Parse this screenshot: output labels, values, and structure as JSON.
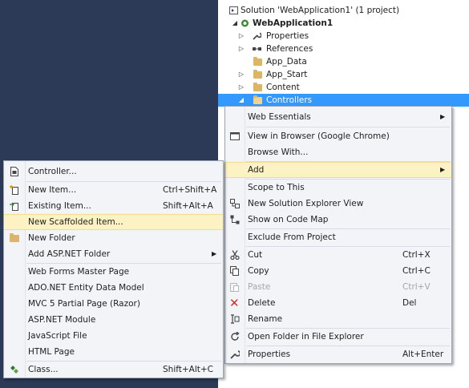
{
  "solution_explorer": {
    "solution_label": "Solution 'WebApplication1' (1 project)",
    "project_label": "WebApplication1",
    "nodes": [
      {
        "label": "Properties"
      },
      {
        "label": "References"
      },
      {
        "label": "App_Data"
      },
      {
        "label": "App_Start"
      },
      {
        "label": "Content"
      },
      {
        "label": "Controllers"
      }
    ]
  },
  "context_menu": {
    "web_essentials": "Web Essentials",
    "view_in_browser": "View in Browser (Google Chrome)",
    "browse_with": "Browse With...",
    "add": "Add",
    "scope_to_this": "Scope to This",
    "new_solution_explorer_view": "New Solution Explorer View",
    "show_on_code_map": "Show on Code Map",
    "exclude_from_project": "Exclude From Project",
    "cut": {
      "label": "Cut",
      "shortcut": "Ctrl+X"
    },
    "copy": {
      "label": "Copy",
      "shortcut": "Ctrl+C"
    },
    "paste": {
      "label": "Paste",
      "shortcut": "Ctrl+V"
    },
    "delete": {
      "label": "Delete",
      "shortcut": "Del"
    },
    "rename": "Rename",
    "open_folder": "Open Folder in File Explorer",
    "properties": {
      "label": "Properties",
      "shortcut": "Alt+Enter"
    }
  },
  "add_submenu": {
    "controller": "Controller...",
    "new_item": {
      "label": "New Item...",
      "shortcut": "Ctrl+Shift+A"
    },
    "existing_item": {
      "label": "Existing Item...",
      "shortcut": "Shift+Alt+A"
    },
    "new_scaffolded_item": "New Scaffolded Item...",
    "new_folder": "New Folder",
    "add_aspnet_folder": "Add ASP.NET Folder",
    "web_forms_master_page": "Web Forms Master Page",
    "ado_net_entity_data_model": "ADO.NET Entity Data Model",
    "mvc5_partial_page": "MVC 5 Partial Page (Razor)",
    "aspnet_module": "ASP.NET Module",
    "javascript_file": "JavaScript File",
    "html_page": "HTML Page",
    "class": {
      "label": "Class...",
      "shortcut": "Shift+Alt+C"
    }
  },
  "colors": {
    "background_dark": "#2c3a57",
    "selection_blue": "#3399ff",
    "menu_highlight": "#fcf2c4",
    "menu_background": "#f3f4f8"
  }
}
